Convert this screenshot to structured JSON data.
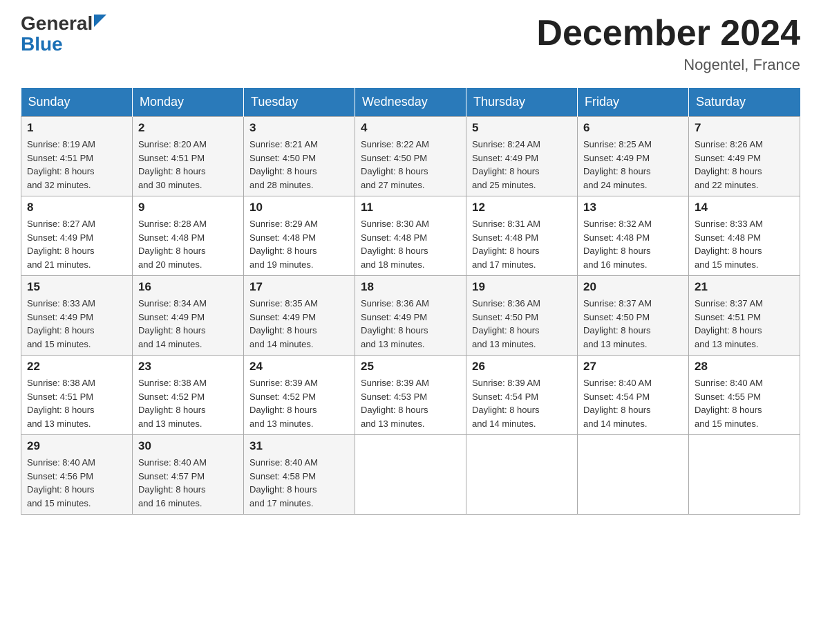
{
  "header": {
    "logo_general": "General",
    "logo_blue": "Blue",
    "month_title": "December 2024",
    "location": "Nogentel, France"
  },
  "days_of_week": [
    "Sunday",
    "Monday",
    "Tuesday",
    "Wednesday",
    "Thursday",
    "Friday",
    "Saturday"
  ],
  "weeks": [
    [
      {
        "day": "1",
        "sunrise": "8:19 AM",
        "sunset": "4:51 PM",
        "daylight": "8 hours and 32 minutes."
      },
      {
        "day": "2",
        "sunrise": "8:20 AM",
        "sunset": "4:51 PM",
        "daylight": "8 hours and 30 minutes."
      },
      {
        "day": "3",
        "sunrise": "8:21 AM",
        "sunset": "4:50 PM",
        "daylight": "8 hours and 28 minutes."
      },
      {
        "day": "4",
        "sunrise": "8:22 AM",
        "sunset": "4:50 PM",
        "daylight": "8 hours and 27 minutes."
      },
      {
        "day": "5",
        "sunrise": "8:24 AM",
        "sunset": "4:49 PM",
        "daylight": "8 hours and 25 minutes."
      },
      {
        "day": "6",
        "sunrise": "8:25 AM",
        "sunset": "4:49 PM",
        "daylight": "8 hours and 24 minutes."
      },
      {
        "day": "7",
        "sunrise": "8:26 AM",
        "sunset": "4:49 PM",
        "daylight": "8 hours and 22 minutes."
      }
    ],
    [
      {
        "day": "8",
        "sunrise": "8:27 AM",
        "sunset": "4:49 PM",
        "daylight": "8 hours and 21 minutes."
      },
      {
        "day": "9",
        "sunrise": "8:28 AM",
        "sunset": "4:48 PM",
        "daylight": "8 hours and 20 minutes."
      },
      {
        "day": "10",
        "sunrise": "8:29 AM",
        "sunset": "4:48 PM",
        "daylight": "8 hours and 19 minutes."
      },
      {
        "day": "11",
        "sunrise": "8:30 AM",
        "sunset": "4:48 PM",
        "daylight": "8 hours and 18 minutes."
      },
      {
        "day": "12",
        "sunrise": "8:31 AM",
        "sunset": "4:48 PM",
        "daylight": "8 hours and 17 minutes."
      },
      {
        "day": "13",
        "sunrise": "8:32 AM",
        "sunset": "4:48 PM",
        "daylight": "8 hours and 16 minutes."
      },
      {
        "day": "14",
        "sunrise": "8:33 AM",
        "sunset": "4:48 PM",
        "daylight": "8 hours and 15 minutes."
      }
    ],
    [
      {
        "day": "15",
        "sunrise": "8:33 AM",
        "sunset": "4:49 PM",
        "daylight": "8 hours and 15 minutes."
      },
      {
        "day": "16",
        "sunrise": "8:34 AM",
        "sunset": "4:49 PM",
        "daylight": "8 hours and 14 minutes."
      },
      {
        "day": "17",
        "sunrise": "8:35 AM",
        "sunset": "4:49 PM",
        "daylight": "8 hours and 14 minutes."
      },
      {
        "day": "18",
        "sunrise": "8:36 AM",
        "sunset": "4:49 PM",
        "daylight": "8 hours and 13 minutes."
      },
      {
        "day": "19",
        "sunrise": "8:36 AM",
        "sunset": "4:50 PM",
        "daylight": "8 hours and 13 minutes."
      },
      {
        "day": "20",
        "sunrise": "8:37 AM",
        "sunset": "4:50 PM",
        "daylight": "8 hours and 13 minutes."
      },
      {
        "day": "21",
        "sunrise": "8:37 AM",
        "sunset": "4:51 PM",
        "daylight": "8 hours and 13 minutes."
      }
    ],
    [
      {
        "day": "22",
        "sunrise": "8:38 AM",
        "sunset": "4:51 PM",
        "daylight": "8 hours and 13 minutes."
      },
      {
        "day": "23",
        "sunrise": "8:38 AM",
        "sunset": "4:52 PM",
        "daylight": "8 hours and 13 minutes."
      },
      {
        "day": "24",
        "sunrise": "8:39 AM",
        "sunset": "4:52 PM",
        "daylight": "8 hours and 13 minutes."
      },
      {
        "day": "25",
        "sunrise": "8:39 AM",
        "sunset": "4:53 PM",
        "daylight": "8 hours and 13 minutes."
      },
      {
        "day": "26",
        "sunrise": "8:39 AM",
        "sunset": "4:54 PM",
        "daylight": "8 hours and 14 minutes."
      },
      {
        "day": "27",
        "sunrise": "8:40 AM",
        "sunset": "4:54 PM",
        "daylight": "8 hours and 14 minutes."
      },
      {
        "day": "28",
        "sunrise": "8:40 AM",
        "sunset": "4:55 PM",
        "daylight": "8 hours and 15 minutes."
      }
    ],
    [
      {
        "day": "29",
        "sunrise": "8:40 AM",
        "sunset": "4:56 PM",
        "daylight": "8 hours and 15 minutes."
      },
      {
        "day": "30",
        "sunrise": "8:40 AM",
        "sunset": "4:57 PM",
        "daylight": "8 hours and 16 minutes."
      },
      {
        "day": "31",
        "sunrise": "8:40 AM",
        "sunset": "4:58 PM",
        "daylight": "8 hours and 17 minutes."
      },
      null,
      null,
      null,
      null
    ]
  ],
  "labels": {
    "sunrise": "Sunrise:",
    "sunset": "Sunset:",
    "daylight": "Daylight:"
  }
}
